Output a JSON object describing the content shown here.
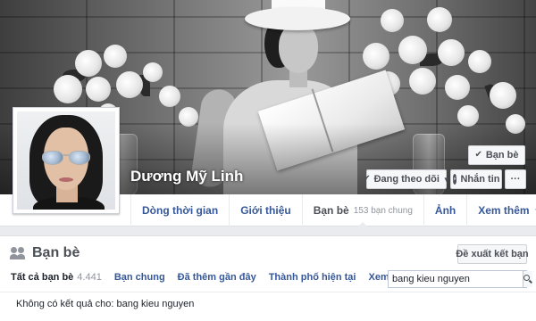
{
  "profile": {
    "name": "Dương Mỹ Linh"
  },
  "cover_actions": {
    "friends_label": "Bạn bè",
    "follow_label": "Đang theo dõi",
    "message_label": "Nhắn tin",
    "more_label": "···"
  },
  "nav": {
    "tabs": [
      {
        "label": "Dòng thời gian"
      },
      {
        "label": "Giới thiệu"
      },
      {
        "label": "Bạn bè",
        "count": "153 bạn chung",
        "active": true
      },
      {
        "label": "Ảnh"
      },
      {
        "label": "Xem thêm"
      }
    ]
  },
  "friends_section": {
    "title": "Bạn bè",
    "suggest_button": "Đề xuất kết bạn",
    "tabs": [
      {
        "label": "Tất cả bạn bè",
        "count": "4.441",
        "active": true
      },
      {
        "label": "Bạn chung"
      },
      {
        "label": "Đã thêm gần đây"
      },
      {
        "label": "Thành phố hiện tại"
      },
      {
        "label": "Xem thêm"
      }
    ],
    "search": {
      "value": "bang kieu nguyen",
      "placeholder": ""
    },
    "no_results": "Không có kết quả cho: bang kieu nguyen"
  },
  "colors": {
    "link": "#365899",
    "page_bg": "#e9ebee",
    "muted": "#90949c"
  },
  "icons": {
    "friends_check": "check-icon",
    "follow_check": "check-icon",
    "message": "messenger-icon",
    "search": "search-icon",
    "friends_section": "people-icon",
    "more_caret": "chevron-down-icon"
  }
}
